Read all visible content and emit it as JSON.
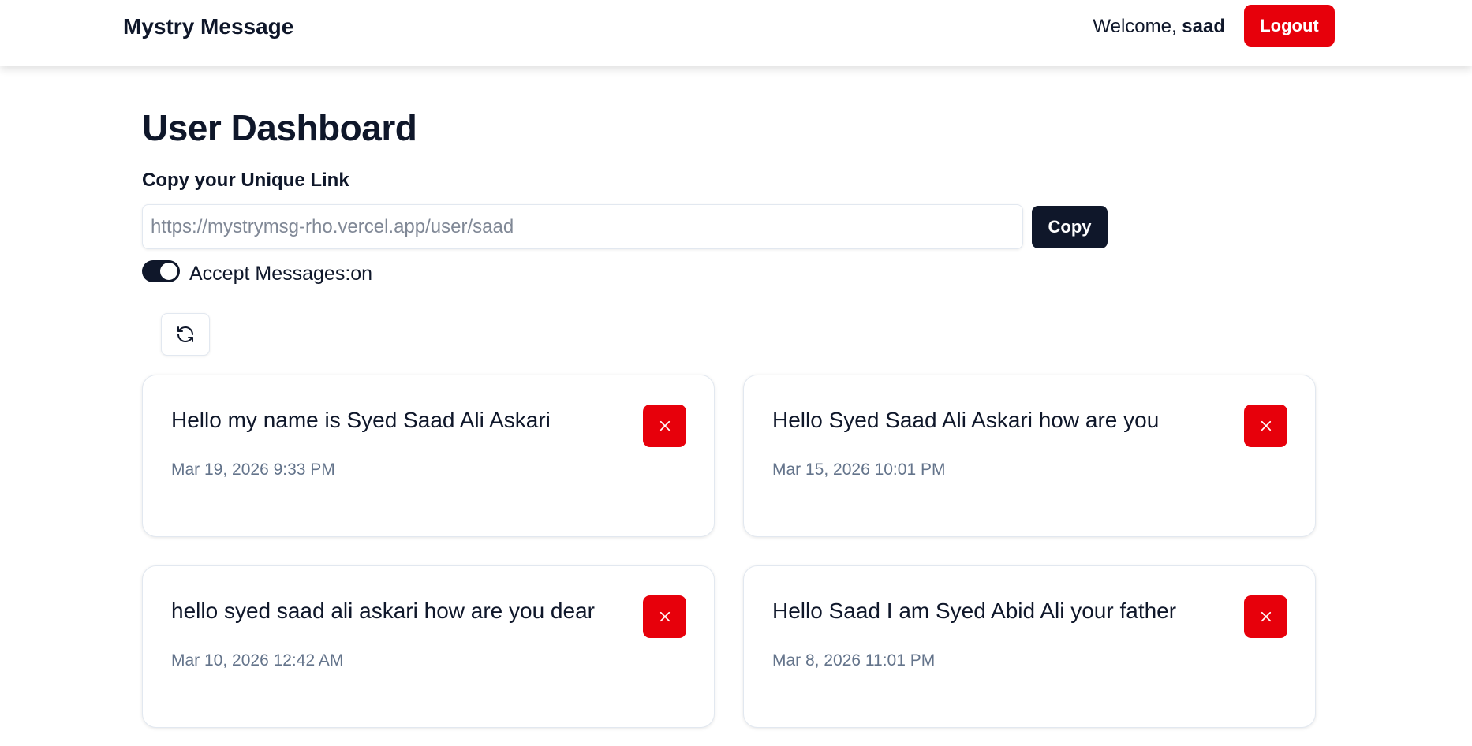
{
  "navbar": {
    "brand": "Mystry Message",
    "welcome_prefix": "Welcome, ",
    "username": "saad",
    "logout_label": "Logout"
  },
  "dashboard": {
    "title": "User Dashboard",
    "link_label": "Copy your Unique Link",
    "link_value": "https://mystrymsg-rho.vercel.app/user/saad",
    "copy_label": "Copy",
    "accept_label": "Accept Messages:on",
    "accept_enabled": true,
    "refresh_icon": "refresh-icon"
  },
  "messages": [
    {
      "content": "Hello my name is Syed Saad Ali Askari",
      "date": "Mar 19, 2026 9:33 PM"
    },
    {
      "content": "Hello Syed Saad Ali Askari how are you",
      "date": "Mar 15, 2026 10:01 PM"
    },
    {
      "content": "hello syed saad ali askari how are you dear",
      "date": "Mar 10, 2026 12:42 AM"
    },
    {
      "content": "Hello Saad I am Syed Abid Ali your father",
      "date": "Mar 8, 2026 11:01 PM"
    }
  ],
  "colors": {
    "accent_red": "#e7000b",
    "dark": "#0f172a",
    "muted_text": "#64748b"
  }
}
